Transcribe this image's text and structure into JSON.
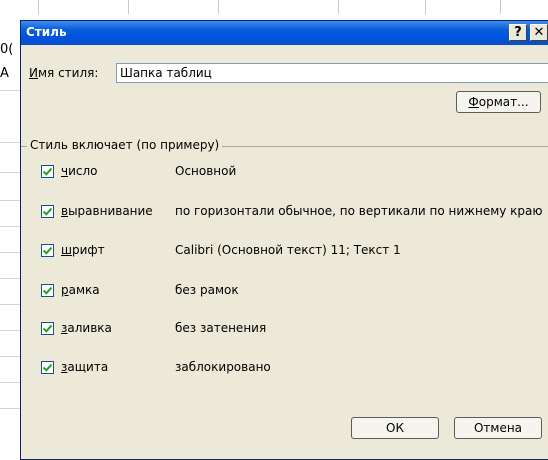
{
  "dialog": {
    "title": "Стиль",
    "help_label": "?",
    "close_label": "✕",
    "style_name_label_prefix": "",
    "style_name_label_u": "И",
    "style_name_label_rest": "мя стиля:",
    "style_name_value": "Шапка таблиц",
    "format_button": {
      "u": "Ф",
      "rest": "ормат..."
    },
    "group_label": "Стиль включает (по примеру)",
    "items": [
      {
        "u": "ч",
        "rest": "исло",
        "value": "Основной",
        "checked": true
      },
      {
        "u": "в",
        "rest": "ыравнивание",
        "value": "по горизонтали обычное, по вертикали по нижнему краю",
        "checked": true
      },
      {
        "u": "ш",
        "rest": "рифт",
        "value": "Calibri (Основной текст) 11; Текст 1",
        "checked": true
      },
      {
        "u": "р",
        "rest": "амка",
        "value": "без рамок",
        "checked": true
      },
      {
        "u": "з",
        "rest": "аливка",
        "value": "без затенения",
        "checked": true
      },
      {
        "u": "з",
        "rest": "ащита",
        "value": "заблокировано",
        "checked": true
      }
    ],
    "ok_button": "ОК",
    "cancel_button": "Отмена"
  },
  "background": {
    "fragment_1": "0(",
    "fragment_2": "А"
  },
  "colors": {
    "titlebar": "#0054e3",
    "dialog_bg": "#ece9d8",
    "check": "#21a121"
  }
}
